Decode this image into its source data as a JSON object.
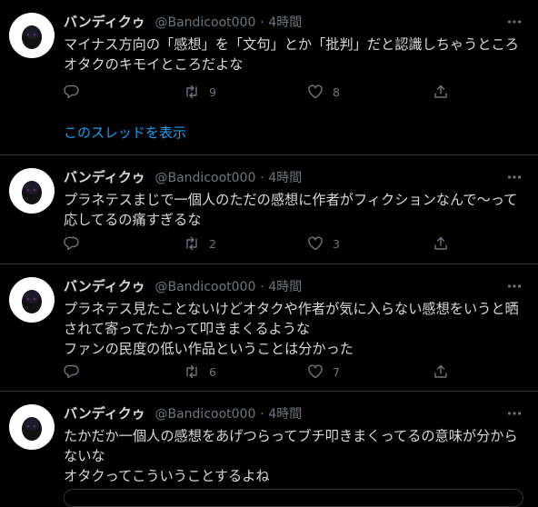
{
  "colors": {
    "background": "#000000",
    "text": "#d9d9d9",
    "muted": "#6e767d",
    "link": "#1d9bf0",
    "divider": "#2f3336"
  },
  "icons": {
    "reply": "reply-icon",
    "retweet": "retweet-icon",
    "like": "heart-icon",
    "share": "share-icon",
    "more": "more-icon"
  },
  "tweets": [
    {
      "name": "バンディクゥ",
      "handle": "@Bandicoot000",
      "separator": "·",
      "time": "4時間",
      "text": "マイナス方向の「感想」を「文句」とか「批判」だと認識しちゃうところ\nオタクのキモイところだよな",
      "replies": "",
      "retweets": "9",
      "likes": "8",
      "thread_link": "このスレッドを表示"
    },
    {
      "name": "バンディクゥ",
      "handle": "@Bandicoot000",
      "separator": "·",
      "time": "4時間",
      "text": "プラネテスまじで一個人のただの感想に作者がフィクションなんで〜って\n応してるの痛すぎるな",
      "replies": "",
      "retweets": "2",
      "likes": "3"
    },
    {
      "name": "バンディクゥ",
      "handle": "@Bandicoot000",
      "separator": "·",
      "time": "4時間",
      "text": "プラネテス見たことないけどオタクや作者が気に入らない感想をいうと晒\nされて寄ってたかって叩きまくるような\nファンの民度の低い作品ということは分かった",
      "replies": "",
      "retweets": "6",
      "likes": "7"
    },
    {
      "name": "バンディクゥ",
      "handle": "@Bandicoot000",
      "separator": "·",
      "time": "4時間",
      "text": "たかだか一個人の感想をあげつらってブチ叩きまくってるの意味が分から\nないな\nオタクってこういうことするよね"
    }
  ]
}
